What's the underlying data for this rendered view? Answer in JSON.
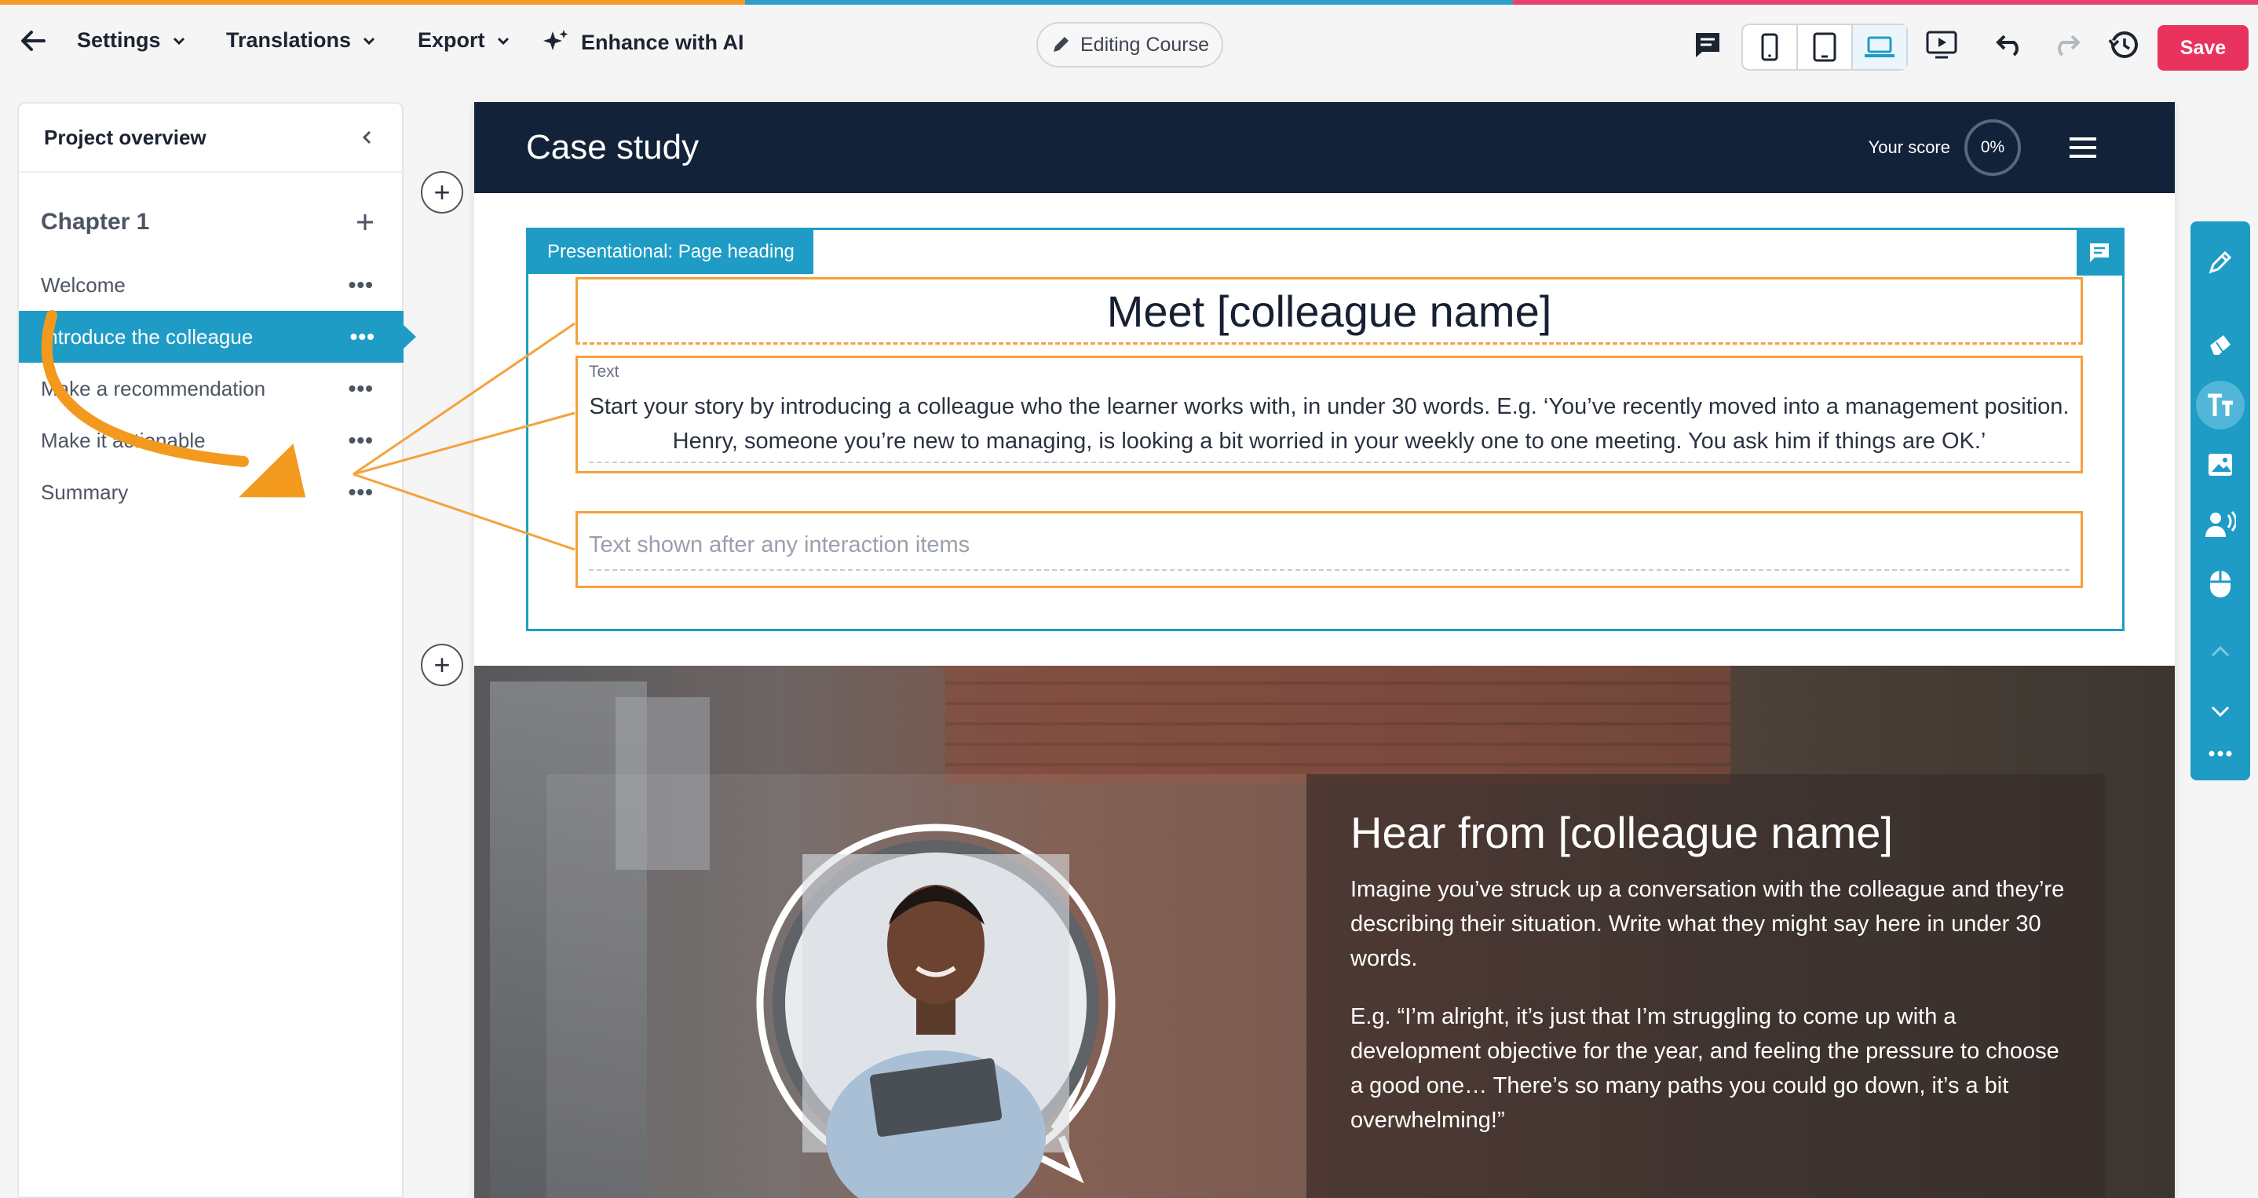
{
  "toolbar": {
    "settings": "Settings",
    "translations": "Translations",
    "export": "Export",
    "enhance": "Enhance with AI",
    "editing_mode": "Editing Course",
    "save": "Save"
  },
  "sidebar": {
    "title": "Project overview",
    "chapter": "Chapter 1",
    "items": [
      {
        "label": "Welcome"
      },
      {
        "label": "Introduce the colleague"
      },
      {
        "label": "Make a recommendation"
      },
      {
        "label": "Make it actionable"
      },
      {
        "label": "Summary"
      }
    ],
    "more": "•••"
  },
  "course": {
    "title": "Case study",
    "score_label": "Your score",
    "score_value": "0%"
  },
  "block": {
    "tag": "Presentational: Page heading",
    "heading": "Meet [colleague name]",
    "text_label": "Text",
    "text_body": "Start your story by introducing a colleague who the learner works with, in under 30 words. E.g. ‘You’ve recently moved into a management position. Henry, someone you’re new to managing, is looking a bit worried in your weekly one to one meeting. You ask him if things are OK.’",
    "after_placeholder": "Text shown after any interaction items"
  },
  "hero": {
    "title": "Hear from [colleague name]",
    "p1": "Imagine you’ve struck up a conversation with the colleague and they’re describing their situation. Write what they might say here in under 30 words.",
    "p2": "E.g. “I’m alright, it’s just that I’m struggling to come up with a development objective for the year, and feeling the pressure to choose a good one… There’s so many paths you could go down, it’s a bit overwhelming!”"
  },
  "colors": {
    "accent": "#1f9cc5",
    "save": "#e8335f",
    "highlight": "#f4a23c",
    "header": "#122238"
  },
  "icons": [
    "back-arrow-icon",
    "chevron-down-icon",
    "sparkle-icon",
    "pencil-icon",
    "comment-icon",
    "phone-icon",
    "tablet-icon",
    "laptop-icon",
    "preview-icon",
    "undo-icon",
    "redo-icon",
    "history-icon",
    "chevron-left-icon",
    "plus-icon",
    "more-icon",
    "menu-icon",
    "brush-icon",
    "eraser-icon",
    "text-icon",
    "image-icon",
    "audio-icon",
    "mouse-icon",
    "chevron-up-icon"
  ]
}
